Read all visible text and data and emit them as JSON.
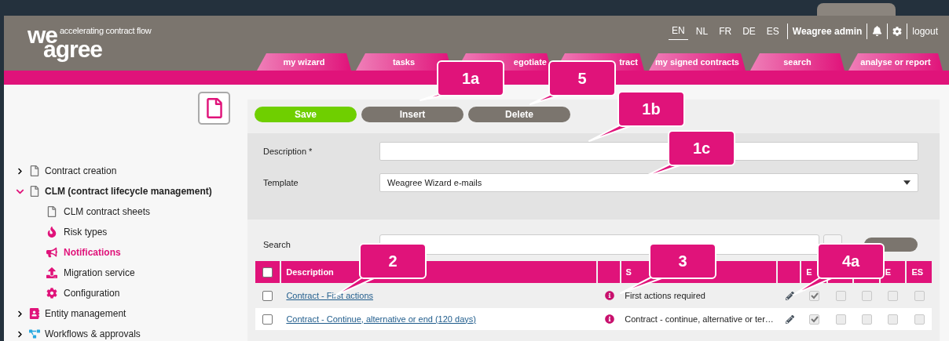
{
  "header": {
    "logo": {
      "top": "we",
      "bottom": "agree",
      "tagline": "accelerating contract flow"
    },
    "languages": [
      {
        "label": "EN",
        "selected": true
      },
      {
        "label": "NL",
        "selected": false
      },
      {
        "label": "FR",
        "selected": false
      },
      {
        "label": "DE",
        "selected": false
      },
      {
        "label": "ES",
        "selected": false
      }
    ],
    "user": "Weagree admin",
    "logout": "logout",
    "tabs": [
      {
        "label": "my wizard"
      },
      {
        "label": "tasks"
      },
      {
        "label": "egotiate"
      },
      {
        "label": "tract"
      },
      {
        "label": "my signed contracts"
      },
      {
        "label": "search"
      },
      {
        "label": "analyse or report"
      }
    ]
  },
  "sidebar": {
    "items": [
      {
        "label": "Contract creation",
        "kind": "document",
        "expanded": false,
        "selected": false
      },
      {
        "label": "CLM (contract lifecycle management)",
        "kind": "document",
        "expanded": true,
        "selected": false,
        "children": [
          {
            "label": "CLM contract sheets",
            "kind": "document",
            "selected": false
          },
          {
            "label": "Risk types",
            "kind": "fire",
            "selected": false
          },
          {
            "label": "Notifications",
            "kind": "megaphone",
            "selected": true
          },
          {
            "label": "Migration service",
            "kind": "upload",
            "selected": false
          },
          {
            "label": "Configuration",
            "kind": "gear",
            "selected": false
          }
        ]
      },
      {
        "label": "Entity management",
        "kind": "contact",
        "expanded": false,
        "selected": false
      },
      {
        "label": "Workflows & approvals",
        "kind": "flow",
        "expanded": false,
        "selected": false
      }
    ]
  },
  "toolbar": [
    {
      "label": "Save",
      "kind": "primary"
    },
    {
      "label": "Insert",
      "kind": "secondary"
    },
    {
      "label": "Delete",
      "kind": "secondary"
    }
  ],
  "form": [
    {
      "label": "Description *",
      "kind": "text"
    },
    {
      "label": "Template",
      "kind": "select",
      "value": "Weagree Wizard e-mails"
    }
  ],
  "search": {
    "label": "Search"
  },
  "table": {
    "all_selected": false,
    "columns": [
      "Description",
      "",
      "S",
      "",
      "E",
      "",
      "",
      "E",
      "ES"
    ],
    "rows": [
      {
        "description": "Contract - First actions",
        "subject": "First actions required",
        "selected": false,
        "languages": [
          true,
          false,
          false,
          false,
          false
        ]
      },
      {
        "description": "Contract - Continue, alternative or end (120 days)",
        "subject": "Contract - continue, alternative or ter…",
        "selected": false,
        "languages": [
          true,
          false,
          false,
          false,
          false
        ]
      }
    ]
  },
  "callouts": [
    {
      "label": "1a"
    },
    {
      "label": "5"
    },
    {
      "label": "1b"
    },
    {
      "label": "1c"
    },
    {
      "label": "2"
    },
    {
      "label": "3"
    },
    {
      "label": "4a"
    }
  ]
}
